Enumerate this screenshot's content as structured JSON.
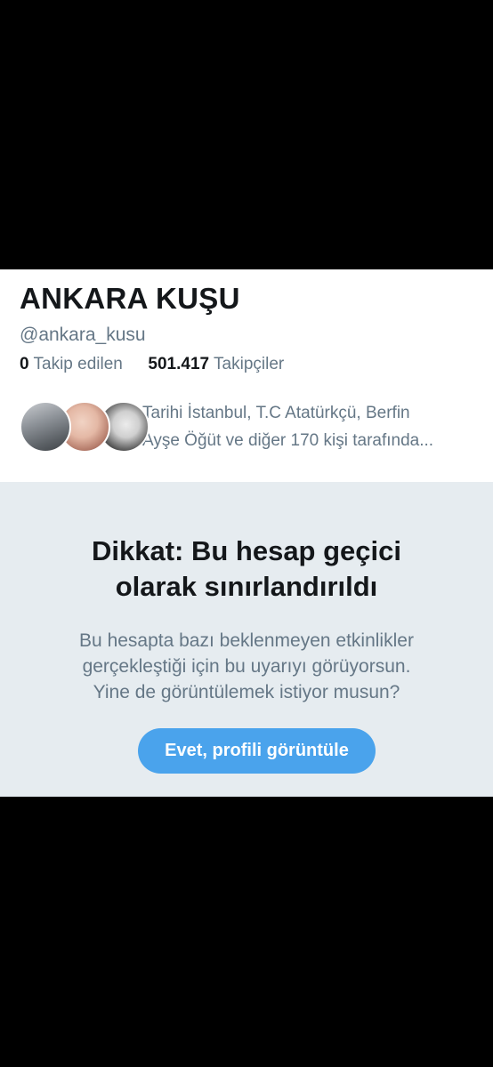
{
  "profile": {
    "display_name": "ANKARA KUŞU",
    "handle": "@ankara_kusu",
    "following_count": "0",
    "following_label": "Takip edilen",
    "followers_count": "501.417",
    "followers_label": "Takipçiler",
    "followed_by_line1": "Tarihi İstanbul, T.C Atatürkçü, Berfin",
    "followed_by_line2": "Ayşe Öğüt ve diğer 170 kişi tarafında..."
  },
  "warning": {
    "title_line1": "Dikkat: Bu hesap geçici",
    "title_line2": "olarak sınırlandırıldı",
    "body_line1": "Bu hesapta bazı beklenmeyen etkinlikler",
    "body_line2": "gerçekleştiği için bu uyarıyı görüyorsun.",
    "body_line3": "Yine de görüntülemek istiyor musun?",
    "button_label": "Evet, profili görüntüle"
  },
  "colors": {
    "background": "#000000",
    "card": "#ffffff",
    "panel": "#e6ecf0",
    "primary_text": "#14171a",
    "secondary_text": "#657786",
    "accent": "#4aa3ec"
  }
}
